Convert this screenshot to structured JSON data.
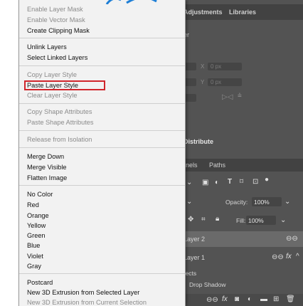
{
  "photoshop_panel": {
    "tabs": [
      "Adjustments",
      "Libraries"
    ],
    "properties": {
      "label_partial": "er",
      "x_label": "X",
      "y_label": "Y",
      "x_value": "0 px",
      "y_value": "0 px",
      "distribute_label": "Distribute"
    },
    "layers_tabs": [
      "nnels",
      "Paths"
    ],
    "opacity_label": "Opacity:",
    "opacity_value": "100%",
    "fill_label": "Fill:",
    "fill_value": "100%",
    "layers": [
      {
        "name": "Layer 2"
      },
      {
        "name": "Layer 1"
      }
    ],
    "effects_label": "ffects",
    "drop_shadow_label": "Drop Shadow"
  },
  "context_menu": {
    "groups": [
      {
        "items": [
          {
            "label": "Enable Layer Mask",
            "enabled": false
          },
          {
            "label": "Enable Vector Mask",
            "enabled": false
          },
          {
            "label": "Create Clipping Mask",
            "enabled": true
          }
        ]
      },
      {
        "items": [
          {
            "label": "Unlink Layers",
            "enabled": true
          },
          {
            "label": "Select Linked Layers",
            "enabled": true
          }
        ]
      },
      {
        "items": [
          {
            "label": "Copy Layer Style",
            "enabled": false
          },
          {
            "label": "Paste Layer Style",
            "enabled": true,
            "highlighted": true
          },
          {
            "label": "Clear Layer Style",
            "enabled": false
          }
        ]
      },
      {
        "items": [
          {
            "label": "Copy Shape Attributes",
            "enabled": false
          },
          {
            "label": "Paste Shape Attributes",
            "enabled": false
          }
        ]
      },
      {
        "items": [
          {
            "label": "Release from Isolation",
            "enabled": false
          }
        ]
      },
      {
        "items": [
          {
            "label": "Merge Down",
            "enabled": true
          },
          {
            "label": "Merge Visible",
            "enabled": true
          },
          {
            "label": "Flatten Image",
            "enabled": true
          }
        ]
      },
      {
        "items": [
          {
            "label": "No Color",
            "enabled": true
          },
          {
            "label": "Red",
            "enabled": true
          },
          {
            "label": "Orange",
            "enabled": true
          },
          {
            "label": "Yellow",
            "enabled": true
          },
          {
            "label": "Green",
            "enabled": true
          },
          {
            "label": "Blue",
            "enabled": true
          },
          {
            "label": "Violet",
            "enabled": true
          },
          {
            "label": "Gray",
            "enabled": true
          }
        ]
      },
      {
        "items": [
          {
            "label": "Postcard",
            "enabled": true
          },
          {
            "label": "New 3D Extrusion from Selected Layer",
            "enabled": true
          },
          {
            "label": "New 3D Extrusion from Current Selection",
            "enabled": false
          }
        ]
      }
    ]
  },
  "colors": {
    "highlight_border": "#d0262c",
    "panel_bg": "#535353",
    "menu_bg": "#f2f2f2"
  }
}
